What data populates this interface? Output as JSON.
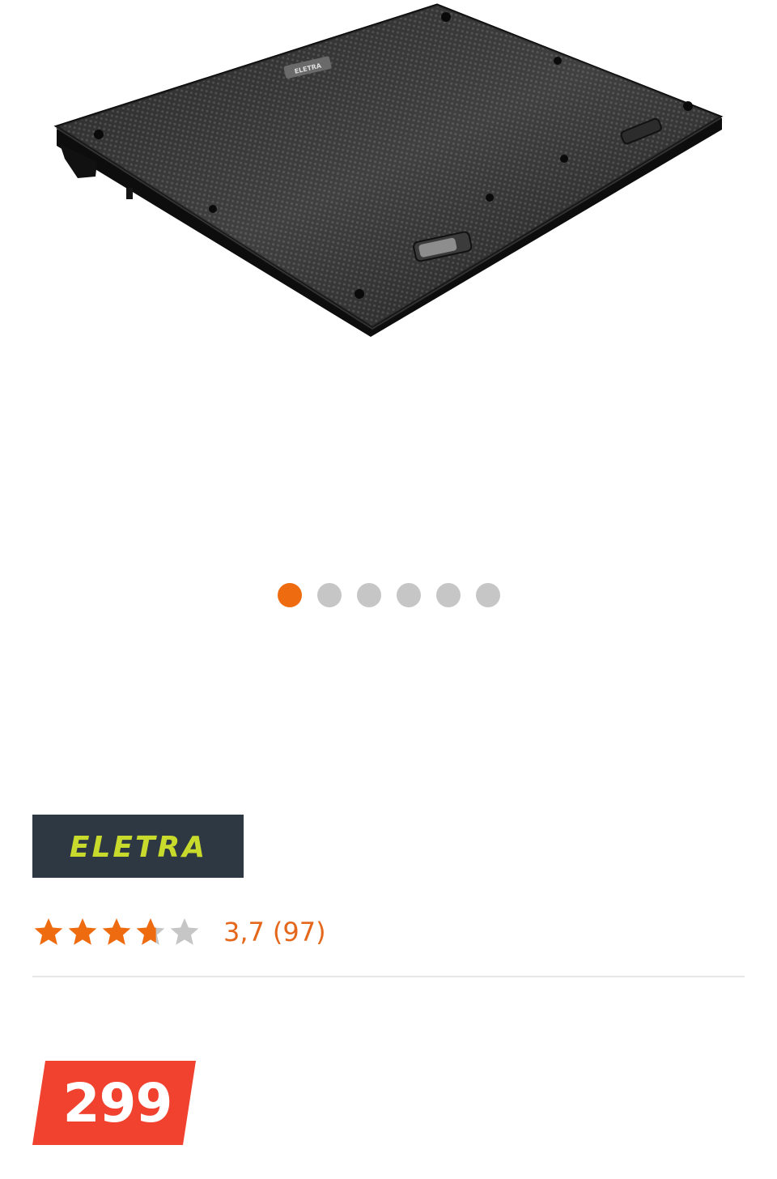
{
  "product": {
    "image_alt": "Laptop cooling pad",
    "image_logo_text": "ELETRA"
  },
  "gallery": {
    "total_images": 6,
    "active_index": 0,
    "active_color": "#ee6b0f",
    "inactive_color": "#c6c6c6"
  },
  "brand": {
    "name": "ELETRA",
    "logo_bg": "#2d3843",
    "logo_color": "#c8da2b"
  },
  "rating": {
    "score": 3.7,
    "max": 5,
    "score_text": "3,7",
    "count_text": "(97)",
    "star_color": "#ee6b0f",
    "star_empty_color": "#c6c6c6"
  },
  "price": {
    "value": "299",
    "badge_color": "#f0422f"
  }
}
